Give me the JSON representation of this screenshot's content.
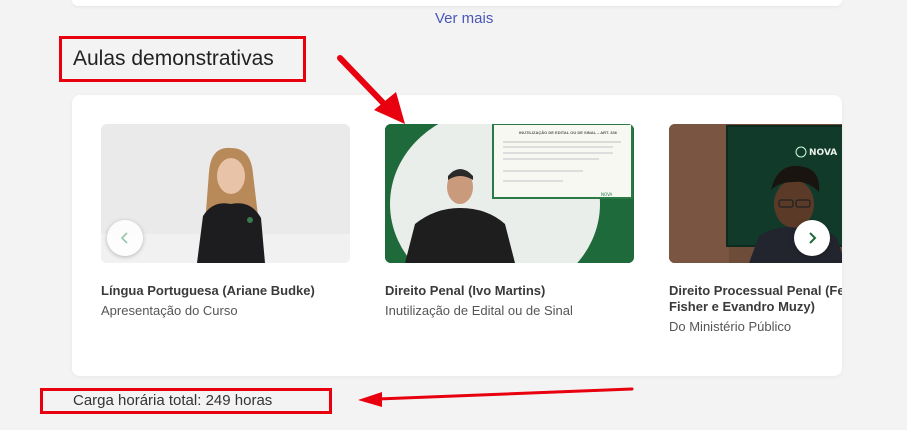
{
  "page": {
    "ver_mais": "Ver mais",
    "section_title": "Aulas demonstrativas",
    "carga_horaria": "Carga horária total: 249 horas"
  },
  "carousel": {
    "items": [
      {
        "title": "Língua Portuguesa (Ariane Budke)",
        "subtitle": "Apresentação do Curso"
      },
      {
        "title": "Direito Penal (Ivo Martins)",
        "subtitle": "Inutilização de Edital ou de Sinal"
      },
      {
        "title": "Direito Processual Penal (Fernando Fisher e Evandro Muzy)",
        "title_line1": "Direito Processual Penal (Fer",
        "title_line2": "Fisher e Evandro Muzy)",
        "subtitle": "Do Ministério Público"
      }
    ],
    "slide_heading": "INUTILIZAÇÃO DE EDITAL OU DE SINAL – ART. 336",
    "logo_text": "NOVA"
  },
  "colors": {
    "accent_blue": "#4b57b8",
    "highlight_red": "#e8000f",
    "brand_green": "#1f6a3a"
  },
  "icons": {
    "prev": "chevron-left-icon",
    "next": "chevron-right-icon"
  }
}
